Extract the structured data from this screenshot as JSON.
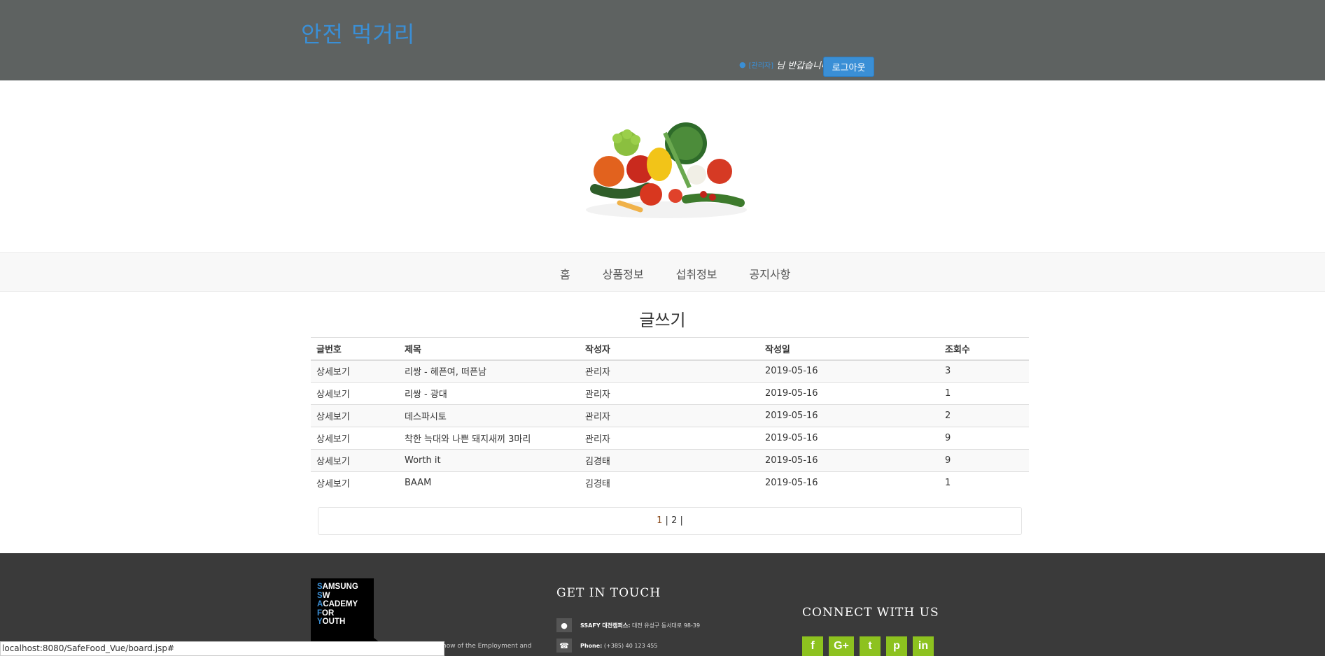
{
  "header": {
    "site_title": "안전 먹거리",
    "user_name": "[관리자]",
    "welcome_text": "님 반갑습니다.",
    "logout_label": "로그아웃"
  },
  "nav": {
    "items": [
      {
        "label": "홈"
      },
      {
        "label": "상품정보"
      },
      {
        "label": "섭취정보"
      },
      {
        "label": "공지사항"
      }
    ]
  },
  "board": {
    "title": "글쓰기",
    "columns": [
      "글번호",
      "제목",
      "작성자",
      "작성일",
      "조회수"
    ],
    "rows": [
      {
        "no": "상세보기",
        "subject": "리쌍 - 헤픈여, 떠픈남",
        "author": "관리자",
        "date": "2019-05-16",
        "views": "3"
      },
      {
        "no": "상세보기",
        "subject": "리쌍 - 광대",
        "author": "관리자",
        "date": "2019-05-16",
        "views": "1"
      },
      {
        "no": "상세보기",
        "subject": "데스파시토",
        "author": "관리자",
        "date": "2019-05-16",
        "views": "2"
      },
      {
        "no": "상세보기",
        "subject": "착한 늑대와 나쁜 돼지새끼 3마리",
        "author": "관리자",
        "date": "2019-05-16",
        "views": "9"
      },
      {
        "no": "상세보기",
        "subject": "Worth it",
        "author": "김경태",
        "date": "2019-05-16",
        "views": "9"
      },
      {
        "no": "상세보기",
        "subject": "BAAM",
        "author": "김경태",
        "date": "2019-05-16",
        "views": "1"
      }
    ],
    "pagination": {
      "page1": "1",
      "sep1": " | ",
      "page2": "2",
      "sep2": " |"
    }
  },
  "footer": {
    "logo_lines": [
      "SAMSUNG",
      "SW",
      "ACADEMY",
      "FOR",
      "YOUTH"
    ],
    "description_fragment": "how of the Employment and",
    "get_in_touch_title": "GET IN TOUCH",
    "address_label": "SSAFY 대전캠퍼스:",
    "address_value": "대전 유성구 동서대로 98-39",
    "phone_label": "Phone:",
    "phone_value": "(+385) 40 123 455",
    "connect_title": "CONNECT WITH US",
    "social": [
      {
        "icon": "facebook-icon",
        "glyph": "f"
      },
      {
        "icon": "google-plus-icon",
        "glyph": "G+"
      },
      {
        "icon": "twitter-icon",
        "glyph": "t"
      },
      {
        "icon": "pinterest-icon",
        "glyph": "p"
      },
      {
        "icon": "linkedin-icon",
        "glyph": "in"
      }
    ]
  },
  "status_bar": {
    "url": "localhost:8080/SafeFood_Vue/board.jsp#"
  },
  "colors": {
    "accent": "#3a8fd6",
    "header_bg": "#5e6261",
    "footer_bg": "#3a3a3a",
    "social_green": "#8dc21f"
  }
}
